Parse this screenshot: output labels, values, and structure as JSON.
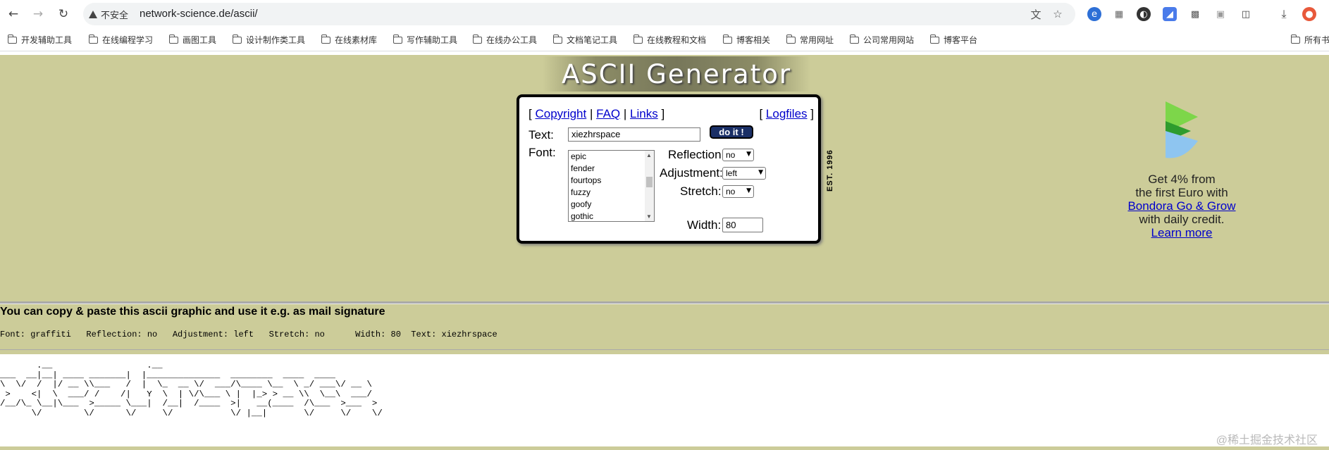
{
  "browser": {
    "security_label": "不安全",
    "url": "network-science.de/ascii/",
    "icons": [
      "back-icon",
      "forward-icon",
      "reload-icon",
      "info-warning-icon",
      "translate-icon",
      "star-icon"
    ],
    "extensions": [
      "extension-blue-icon",
      "extension-grid-icon",
      "extension-dark-icon",
      "extension-blue-square-icon",
      "extension-qr-icon",
      "extension-gray-icon",
      "puzzle-icon",
      "download-icon",
      "profile-icon"
    ]
  },
  "bookmarks": [
    {
      "label": "开发辅助工具"
    },
    {
      "label": "在线编程学习"
    },
    {
      "label": "画图工具"
    },
    {
      "label": "设计制作类工具"
    },
    {
      "label": "在线素材库"
    },
    {
      "label": "写作辅助工具"
    },
    {
      "label": "在线办公工具"
    },
    {
      "label": "文档笔记工具"
    },
    {
      "label": "在线教程和文档"
    },
    {
      "label": "博客相关"
    },
    {
      "label": "常用网址"
    },
    {
      "label": "公司常用网站"
    },
    {
      "label": "博客平台"
    },
    {
      "label": "所有书"
    }
  ],
  "page": {
    "title": "ASCII Generator",
    "links": {
      "open": "[",
      "copyright": "Copyright",
      "sep": "|",
      "faq": "FAQ",
      "links": "Links",
      "close": "]",
      "logfiles": "Logfiles"
    },
    "text_label": "Text:",
    "text_value": "xiezhrspace",
    "do_it": "do it !",
    "font_label": "Font:",
    "fonts": [
      {
        "name": "epic"
      },
      {
        "name": "fender"
      },
      {
        "name": "fourtops"
      },
      {
        "name": "fuzzy"
      },
      {
        "name": "goofy"
      },
      {
        "name": "gothic"
      },
      {
        "name": "graffiti",
        "selected": true
      }
    ],
    "reflection_label": "Reflection:",
    "reflection_value": "no",
    "adjustment_label": "Adjustment:",
    "adjustment_value": "left",
    "stretch_label": "Stretch:",
    "stretch_value": "no",
    "width_label": "Width:",
    "width_value": "80",
    "est": "EST. 1996"
  },
  "ad": {
    "line1": "Get 4% from",
    "line2": "the first Euro with",
    "link": "Bondora Go & Grow",
    "line3": "with daily credit.",
    "learn_more": "Learn more",
    "colors": {
      "green": "#7dd64a",
      "dark_green": "#2e9c2e",
      "blue": "#8ec5f0"
    }
  },
  "result": {
    "message": "You can copy & paste this ascii graphic and use it e.g. as mail signature",
    "meta": "Font: graffiti   Reflection: no   Adjustment: left   Stretch: no      Width: 80  Text: xiezhrspace",
    "ascii": "       .__                  .__                                                                \n___  __|__| ____ _______|  |______________  ________  ____  ____  \n\\  \\/  /  |/ __ \\\\___   /  |  \\_  __ \\/  ___/\\____ \\__  \\ _/ ___\\/ __ \\ \n >    <|  \\  ___/ /    /|   Y  \\  | \\/\\___ \\ |  |_> > __ \\\\  \\__\\  ___/ \n/__/\\_ \\__|\\___  >_____ \\___|  /__|  /____  >|   __(____  /\\___  >___  >\n      \\/        \\/      \\/     \\/           \\/ |__|       \\/     \\/    \\/ "
  },
  "watermark": "@稀土掘金技术社区"
}
